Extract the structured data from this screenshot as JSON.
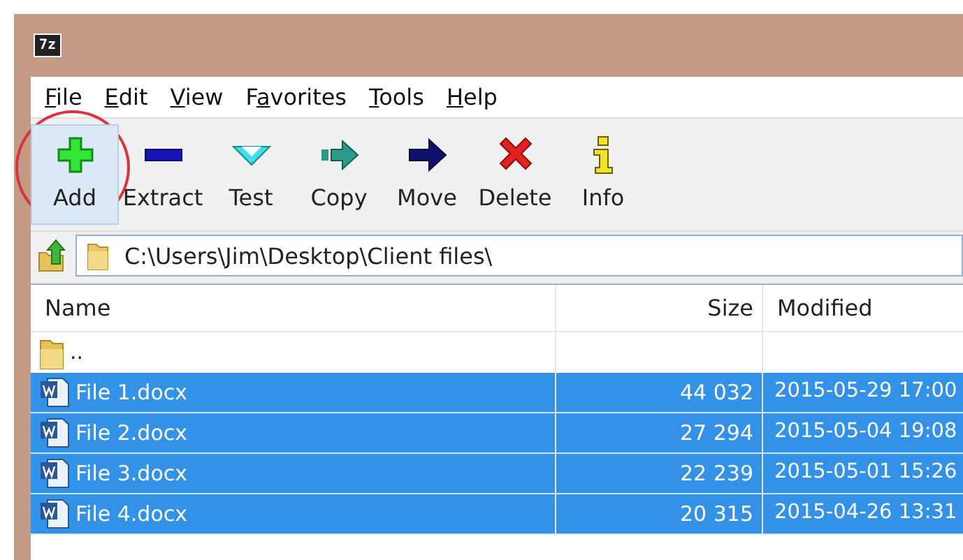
{
  "window": {
    "app_icon": "7z"
  },
  "menu": [
    {
      "segments": [
        {
          "text": "F",
          "underlined": true
        },
        {
          "text": "ile",
          "underlined": false
        }
      ]
    },
    {
      "segments": [
        {
          "text": "E",
          "underlined": true
        },
        {
          "text": "dit",
          "underlined": false
        }
      ]
    },
    {
      "segments": [
        {
          "text": "V",
          "underlined": true
        },
        {
          "text": "iew",
          "underlined": false
        }
      ]
    },
    {
      "segments": [
        {
          "text": "F",
          "underlined": false
        },
        {
          "text": "a",
          "underlined": true
        },
        {
          "text": "vorites",
          "underlined": false
        }
      ]
    },
    {
      "segments": [
        {
          "text": "T",
          "underlined": true
        },
        {
          "text": "ools",
          "underlined": false
        }
      ]
    },
    {
      "segments": [
        {
          "text": "H",
          "underlined": true
        },
        {
          "text": "elp",
          "underlined": false
        }
      ]
    }
  ],
  "toolbar": [
    {
      "label": "Add",
      "kind": "add",
      "highlighted": true
    },
    {
      "label": "Extract",
      "kind": "extract",
      "highlighted": false
    },
    {
      "label": "Test",
      "kind": "test",
      "highlighted": false
    },
    {
      "label": "Copy",
      "kind": "copy",
      "highlighted": false
    },
    {
      "label": "Move",
      "kind": "move",
      "highlighted": false
    },
    {
      "label": "Delete",
      "kind": "delete",
      "highlighted": false
    },
    {
      "label": "Info",
      "kind": "info",
      "highlighted": false
    }
  ],
  "address": {
    "value": "C:\\Users\\Jim\\Desktop\\Client files\\"
  },
  "table": {
    "columns": [
      "Name",
      "Size",
      "Modified"
    ],
    "rows": [
      {
        "kind": "folder",
        "name": "..",
        "selected": false
      },
      {
        "kind": "document",
        "name": "File 1.docx",
        "size": "44 032",
        "modified": "2015-05-29 17:00",
        "selected": true
      },
      {
        "kind": "document",
        "name": "File 2.docx",
        "size": "27 294",
        "modified": "2015-05-04 19:08",
        "selected": true
      },
      {
        "kind": "document",
        "name": "File 3.docx",
        "size": "22 239",
        "modified": "2015-05-01 15:26",
        "selected": true
      },
      {
        "kind": "document",
        "name": "File 4.docx",
        "size": "20 315",
        "modified": "2015-04-26 13:31",
        "selected": true
      }
    ]
  }
}
